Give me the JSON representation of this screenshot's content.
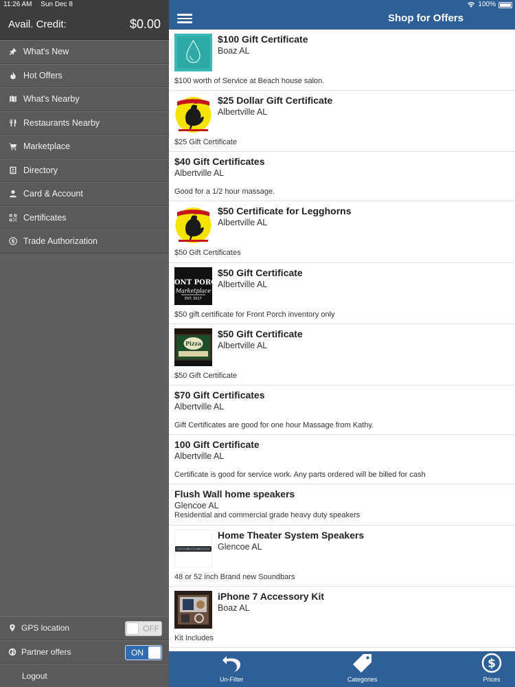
{
  "status": {
    "time": "11:26 AM",
    "date": "Sun Dec 8",
    "battery": "100%"
  },
  "sidebar": {
    "credit_label": "Avail. Credit:",
    "credit_value": "$0.00",
    "items": [
      {
        "label": "What's New",
        "icon": "pin-icon"
      },
      {
        "label": "Hot Offers",
        "icon": "flame-icon"
      },
      {
        "label": "What's Nearby",
        "icon": "map-icon"
      },
      {
        "label": "Restaurants Nearby",
        "icon": "utensils-icon"
      },
      {
        "label": "Marketplace",
        "icon": "cart-icon"
      },
      {
        "label": "Directory",
        "icon": "directory-book-icon"
      },
      {
        "label": "Card & Account",
        "icon": "user-icon"
      },
      {
        "label": "Certificates",
        "icon": "qr-code-icon"
      },
      {
        "label": "Trade Authorization",
        "icon": "dollar-circle-icon"
      }
    ],
    "gps_label": "GPS location",
    "gps_state": "OFF",
    "partner_label": "Partner offers",
    "partner_state": "ON",
    "logout_label": "Logout"
  },
  "header": {
    "title": "Shop for Offers"
  },
  "offers": [
    {
      "title": "$100 Gift Certificate",
      "location": "Boaz AL",
      "description": "$100 worth of Service at Beach house salon.",
      "image": "teal-water-drop"
    },
    {
      "title": "$25 Dollar Gift Certificate",
      "location": "Albertville AL",
      "description": "$25 Gift Certificate",
      "image": "legghorns-logo"
    },
    {
      "title": "$40 Gift Certificates",
      "location": "Albertville AL",
      "description": "Good for a 1/2 hour massage.",
      "image": ""
    },
    {
      "title": "$50 Certificate for Legghorns",
      "location": "Albertville AL",
      "description": "$50 Gift Certificates",
      "image": "legghorns-logo"
    },
    {
      "title": "$50 Gift Certificate",
      "location": "Albertville AL",
      "description": "$50 gift certificate for Front Porch inventory only",
      "image": "front-porch-logo"
    },
    {
      "title": "$50 Gift Certificate",
      "location": "Albertville AL",
      "description": "$50 Gift Certificate",
      "image": "italian-restaurant-sign"
    },
    {
      "title": "$70 Gift Certificates",
      "location": "Albertville AL",
      "description": "Gift Certificates are good for one hour Massage from Kathy.",
      "image": ""
    },
    {
      "title": "100 Gift Certificate",
      "location": "Albertville AL",
      "description": "Certificate is good for service work. Any parts ordered will be billed for cash",
      "image": ""
    },
    {
      "title": "Flush Wall home speakers",
      "location": "Glencoe AL",
      "description": "Residential and commercial grade heavy duty speakers",
      "image": ""
    },
    {
      "title": "Home Theater System Speakers",
      "location": "Glencoe AL",
      "description": "48 or 52 inch Brand new Soundbars",
      "image": "soundbar-photo"
    },
    {
      "title": "iPhone 7 Accessory Kit",
      "location": "Boaz AL",
      "description": "Kit Includes",
      "image": "accessory-kit-photo"
    }
  ],
  "tabs": [
    {
      "label": "Un-Filter",
      "icon": "undo-icon"
    },
    {
      "label": "Categories",
      "icon": "tag-icon"
    },
    {
      "label": "Prices",
      "icon": "dollar-circle-icon"
    }
  ],
  "colors": {
    "brand_blue": "#2e5f96",
    "sidebar_gray": "#5a5a5a",
    "toggle_on": "#2f6cb4"
  }
}
